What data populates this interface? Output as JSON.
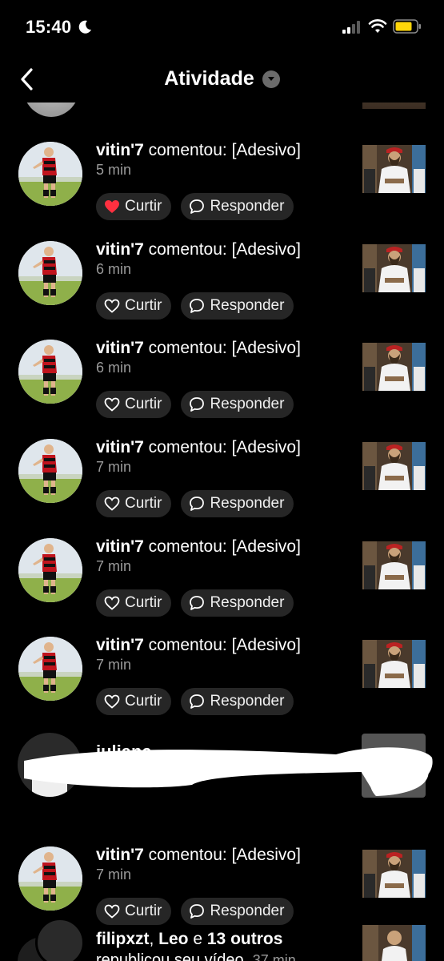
{
  "status_bar": {
    "time": "15:40"
  },
  "header": {
    "title": "Atividade"
  },
  "rows": [
    {
      "user": "vitin'7",
      "action": " comentou: [Adesivo]",
      "time": "5 min",
      "like_label": "Curtir",
      "reply_label": "Responder",
      "liked": true
    },
    {
      "user": "vitin'7",
      "action": " comentou: [Adesivo]",
      "time": "6 min",
      "like_label": "Curtir",
      "reply_label": "Responder",
      "liked": false
    },
    {
      "user": "vitin'7",
      "action": " comentou: [Adesivo]",
      "time": "6 min",
      "like_label": "Curtir",
      "reply_label": "Responder",
      "liked": false
    },
    {
      "user": "vitin'7",
      "action": " comentou: [Adesivo]",
      "time": "7 min",
      "like_label": "Curtir",
      "reply_label": "Responder",
      "liked": false
    },
    {
      "user": "vitin'7",
      "action": " comentou: [Adesivo]",
      "time": "7 min",
      "like_label": "Curtir",
      "reply_label": "Responder",
      "liked": false
    },
    {
      "user": "vitin'7",
      "action": " comentou: [Adesivo]",
      "time": "7 min",
      "like_label": "Curtir",
      "reply_label": "Responder",
      "liked": false
    },
    {
      "user": "vitin'7",
      "action": " comentou: [Adesivo]",
      "time": "7 min",
      "like_label": "Curtir",
      "reply_label": "Responder",
      "liked": false
    }
  ],
  "censored_row": {
    "visible_fragment": "juliana"
  },
  "bottom_row": {
    "users": "filipxzt",
    "mid": ", ",
    "user2": "Leo",
    "connector": " e ",
    "others": "13 outros",
    "line2": "republicou seu vídeo.",
    "time": "37 min"
  },
  "colors": {
    "background": "#000000",
    "pill": "#262626",
    "like_active": "#ff3040",
    "muted_text": "#9a9a9a"
  }
}
